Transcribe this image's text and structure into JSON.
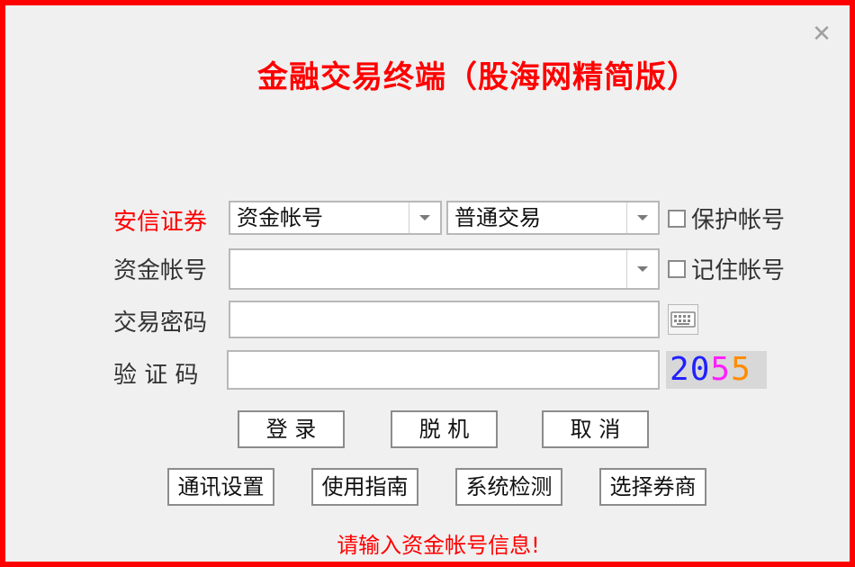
{
  "window": {
    "title": "金融交易终端（股海网精简版）",
    "close_symbol": "✕"
  },
  "form": {
    "broker_label": "安信证券",
    "account_type_select": {
      "value": "资金帐号"
    },
    "trade_type_select": {
      "value": "普通交易"
    },
    "protect_account_label": "保护帐号",
    "account_label": "资金帐号",
    "account_value": "",
    "remember_account_label": "记住帐号",
    "password_label": "交易密码",
    "password_value": "",
    "captcha_label": "验 证 码",
    "captcha_value": "",
    "captcha_code": [
      "2",
      "0",
      "5",
      "5"
    ],
    "captcha_colors": [
      "#2020ff",
      "#2020ff",
      "#ff20ff",
      "#ff8c00"
    ]
  },
  "actions": {
    "login": "登 录",
    "offline": "脱 机",
    "cancel": "取 消"
  },
  "tools": {
    "comm_settings": "通讯设置",
    "user_guide": "使用指南",
    "system_check": "系统检测",
    "choose_broker": "选择券商"
  },
  "status_message": "请输入资金帐号信息!",
  "colors": {
    "accent": "#ff0000",
    "background": "#f0f0f0"
  },
  "icons": {
    "keyboard": "soft-keyboard-icon",
    "dropdown": "chevron-down-icon",
    "close": "close-icon"
  }
}
